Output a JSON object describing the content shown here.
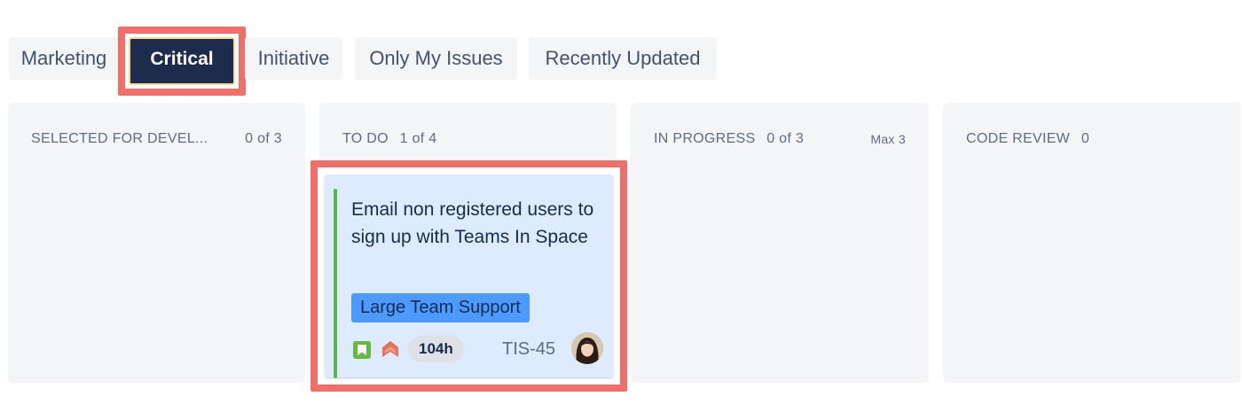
{
  "quick_filters": [
    {
      "label": "Marketing",
      "active": false
    },
    {
      "label": "Critical",
      "active": true
    },
    {
      "label": "Initiative",
      "active": false
    },
    {
      "label": "Only My Issues",
      "active": false
    },
    {
      "label": "Recently Updated",
      "active": false
    }
  ],
  "columns": [
    {
      "title": "SELECTED FOR DEVEL...",
      "count": "0 of 3",
      "max": ""
    },
    {
      "title": "TO DO",
      "count": "1 of 4",
      "max": ""
    },
    {
      "title": "IN PROGRESS",
      "count": "0 of 3",
      "max": "Max 3"
    },
    {
      "title": "CODE REVIEW",
      "count": "0",
      "max": ""
    }
  ],
  "card": {
    "title": "Email non registered users to sign up with Teams In Space",
    "epic": "Large Team Support",
    "estimate": "104h",
    "issue_key": "TIS-45",
    "type_icon": "story-icon",
    "priority_icon": "priority-highest-icon",
    "avatar": "assignee-avatar"
  },
  "colors": {
    "highlight": "#f26e68",
    "active_filter": "#1d2b4d",
    "epic": "#4c9aff",
    "card_bg": "#deebff",
    "story": "#63ba3c",
    "priority": "#e5705b"
  }
}
